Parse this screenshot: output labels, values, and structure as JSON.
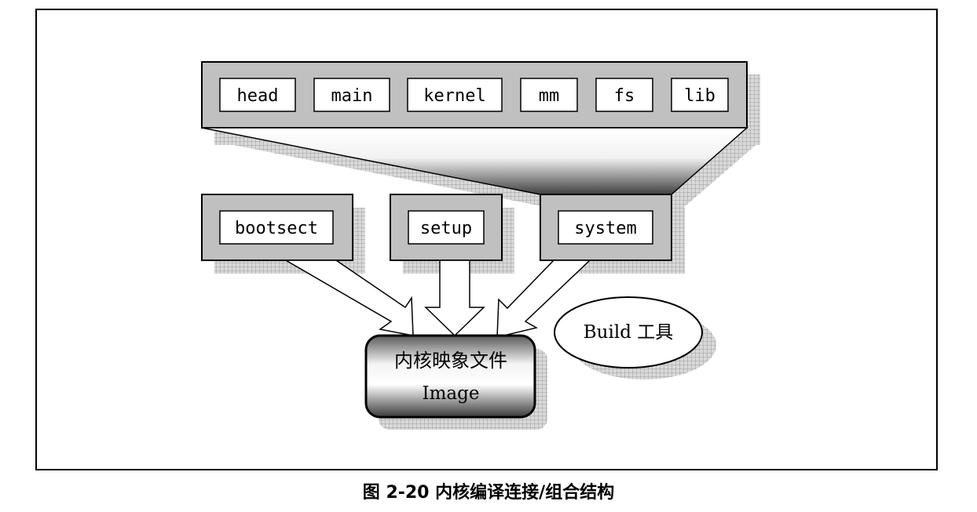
{
  "modules": [
    "head",
    "main",
    "kernel",
    "mm",
    "fs",
    "lib"
  ],
  "components": {
    "bootsect": "bootsect",
    "setup": "setup",
    "system": "system"
  },
  "image": {
    "line1": "内核映象文件",
    "line2": "Image"
  },
  "tool": "Build 工具",
  "caption": "图 2-20 内核编译连接/组合结构"
}
